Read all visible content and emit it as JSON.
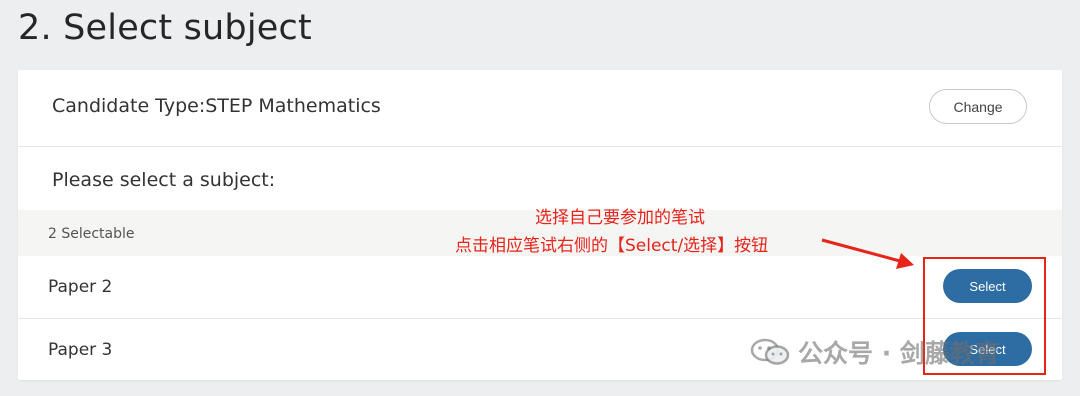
{
  "page": {
    "title": "2. Select subject"
  },
  "candidate": {
    "label": "Candidate Type:STEP Mathematics",
    "change_button": "Change"
  },
  "subject_prompt": "Please select a subject:",
  "selectable_count": "2 Selectable",
  "papers": [
    {
      "name": "Paper 2",
      "button": "Select"
    },
    {
      "name": "Paper 3",
      "button": "Select"
    }
  ],
  "annotations": {
    "line1": "选择自己要参加的笔试",
    "line2": "点击相应笔试右侧的【Select/选择】按钮",
    "color": "#e8231a"
  },
  "watermark": {
    "text": "公众号 · 剑藤教育",
    "icon": "wechat-icon"
  },
  "colors": {
    "primary_button": "#2e6ca4",
    "background": "#eceeef"
  }
}
